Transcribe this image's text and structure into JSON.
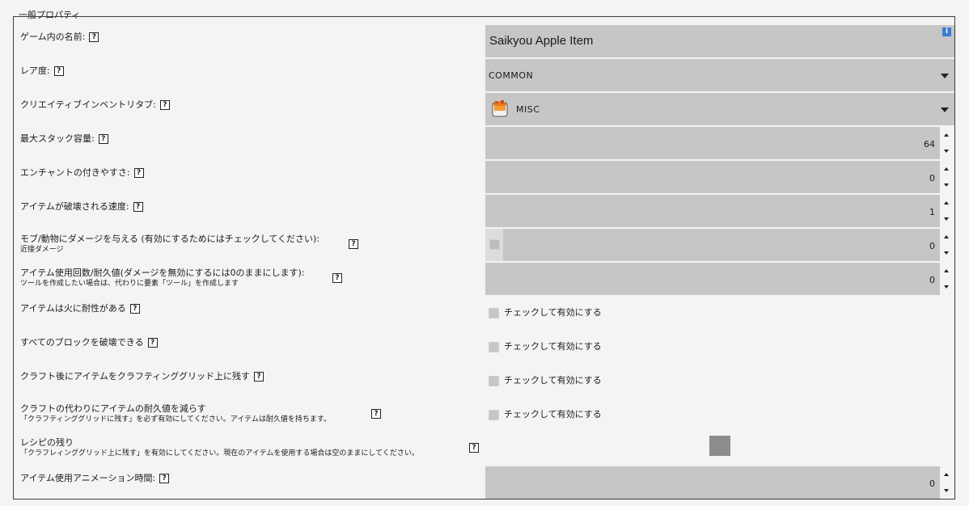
{
  "legend": "一般プロパティ",
  "help_glyph": "?",
  "info_glyph": "i",
  "fields": {
    "name": {
      "label": "ゲーム内の名前:",
      "value": "Saikyou Apple Item"
    },
    "rarity": {
      "label": "レア度:",
      "value": "COMMON"
    },
    "creative_tab": {
      "label": "クリエイティブインベントリタブ:",
      "value": "MISC",
      "icon": "bucket-icon"
    },
    "stack_size": {
      "label": "最大スタック容量:",
      "value": "64"
    },
    "enchantability": {
      "label": "エンチャントの付きやすさ:",
      "value": "0"
    },
    "destroy_speed": {
      "label": "アイテムが破壊される速度:",
      "value": "1"
    },
    "damage": {
      "label": "モブ/動物にダメージを与える (有効にするためにはチェックしてください):",
      "sublabel": "近接ダメージ",
      "value": "0"
    },
    "durability": {
      "label": "アイテム使用回数/耐久値(ダメージを無効にするには0のままにします):",
      "sublabel": "ツールを作成したい場合は、代わりに要素「ツール」を作成します",
      "value": "0"
    },
    "fire_resistant": {
      "label": "アイテムは火に耐性がある",
      "check_label": "チェックして有効にする"
    },
    "break_all": {
      "label": "すべてのブロックを破壊できる",
      "check_label": "チェックして有効にする"
    },
    "stay_in_grid": {
      "label": "クラフト後にアイテムをクラフティンググリッド上に残す",
      "check_label": "チェックして有効にする"
    },
    "damage_on_craft": {
      "label": "クラフトの代わりにアイテムの耐久値を減らす",
      "sublabel": "「クラフティンググリッドに残す」を必ず有効にしてください。アイテムは耐久値を持ちます。",
      "check_label": "チェックして有効にする"
    },
    "recipe_remainder": {
      "label": "レシピの残り",
      "sublabel": "「クラフレィンググリッド上に残す」を有効にしてください。現在のアイテムを使用する場合は空のままにしてください。"
    },
    "use_duration": {
      "label": "アイテム使用アニメーション時間:",
      "value": "0"
    }
  }
}
